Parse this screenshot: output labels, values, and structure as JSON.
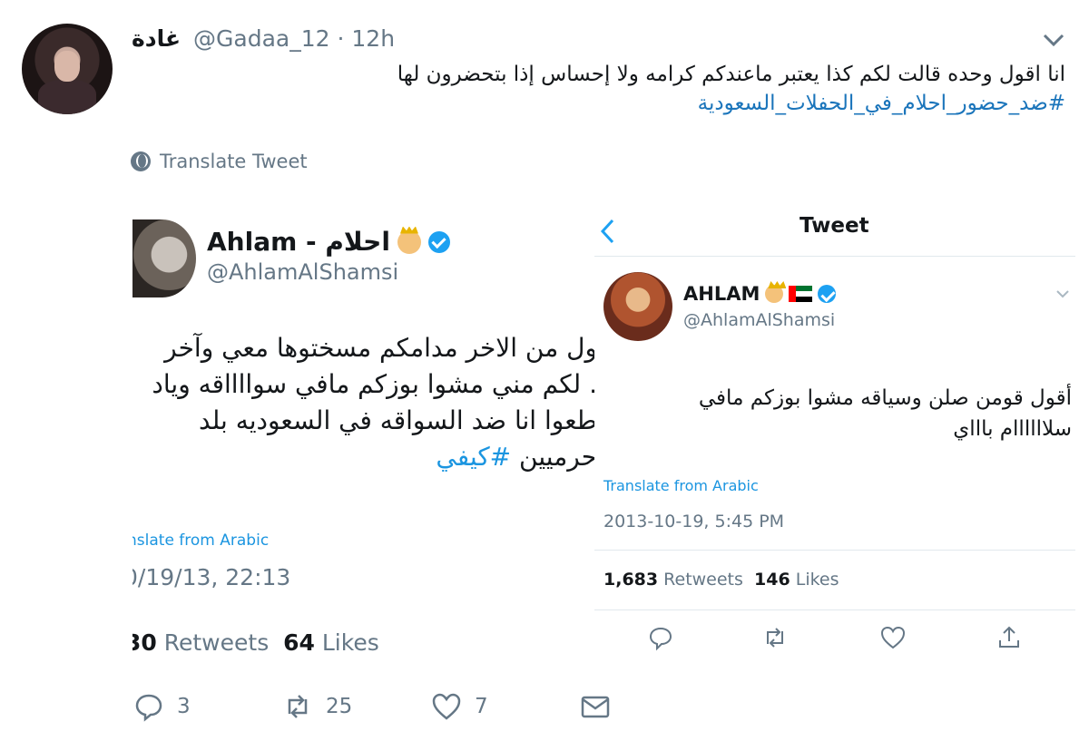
{
  "tweet": {
    "author_name": "غادة",
    "handle": "@Gadaa_12",
    "separator": "·",
    "time": "12h",
    "text": "انا اقول وحده قالت لكم كذا يعتبر ماعندكم كرامه ولا إحساس إذا بتحضرون لها",
    "hashtag": "#ضد_حضور_احلام_في_الحفلات_السعودية",
    "translate_label": "Translate Tweet",
    "reply_count": "3",
    "retweet_count": "25",
    "like_count": "7"
  },
  "left_screenshot": {
    "name": "Ahlam - احلام",
    "handle": "@AhlamAlShamsi",
    "lines": [
      "ول من الاخر مدامكم مسختوها معي وآخر",
      ". لكم مني مشوا بوزكم مافي سوااااقه وياد",
      "طعوا انا ضد السواقه في السعوديه بلد"
    ],
    "last_line_prefix": "حرميين",
    "hashtag": "#كيفي",
    "translate_label": "nslate from Arabic",
    "date": "0/19/13, 22:13",
    "retweets_num": "30",
    "retweets_label": "Retweets",
    "likes_num": "64",
    "likes_label": "Likes"
  },
  "right_screenshot": {
    "title": "Tweet",
    "name": "AHLAM",
    "handle": "@AhlamAlShamsi",
    "line1": "أقول قومن صلن وسياقه مشوا بوزكم مافي",
    "line2": "سلاااااام باااي",
    "translate_label": "Translate from Arabic",
    "date": "2013-10-19, 5:45 PM",
    "retweets_num": "1,683",
    "retweets_label": "Retweets",
    "likes_num": "146",
    "likes_label": "Likes"
  },
  "icons": {
    "menu": "chevron-down-icon",
    "translate": "globe-icon",
    "reply": "reply-icon",
    "retweet": "retweet-icon",
    "like": "heart-icon",
    "message": "envelope-icon",
    "share": "share-icon",
    "back": "chevron-left-icon",
    "verified": "verified-badge-icon",
    "crown": "crown-emoji-icon",
    "flag": "uae-flag-icon"
  },
  "colors": {
    "link": "#1b75bb",
    "muted": "#657786",
    "text": "#14171a",
    "verified": "#1da1f2"
  }
}
